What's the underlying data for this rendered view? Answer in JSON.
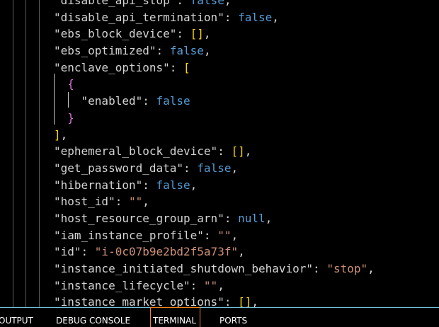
{
  "editor": {
    "lines": [
      [
        {
          "t": "\"disable_api_stop\"",
          "c": "k"
        },
        {
          "t": ": ",
          "c": "p"
        },
        {
          "t": "false",
          "c": "b"
        },
        {
          "t": ",",
          "c": "p"
        }
      ],
      [
        {
          "t": "\"disable_api_termination\"",
          "c": "k"
        },
        {
          "t": ": ",
          "c": "p"
        },
        {
          "t": "false",
          "c": "b"
        },
        {
          "t": ",",
          "c": "p"
        }
      ],
      [
        {
          "t": "\"ebs_block_device\"",
          "c": "k"
        },
        {
          "t": ": ",
          "c": "p"
        },
        {
          "t": "[]",
          "c": "br1"
        },
        {
          "t": ",",
          "c": "p"
        }
      ],
      [
        {
          "t": "\"ebs_optimized\"",
          "c": "k"
        },
        {
          "t": ": ",
          "c": "p"
        },
        {
          "t": "false",
          "c": "b"
        },
        {
          "t": ",",
          "c": "p"
        }
      ],
      [
        {
          "t": "\"enclave_options\"",
          "c": "k"
        },
        {
          "t": ": ",
          "c": "p"
        },
        {
          "t": "[",
          "c": "br1"
        }
      ],
      [
        {
          "t": "  {",
          "c": "br2"
        }
      ],
      [
        {
          "t": "    \"enabled\"",
          "c": "k"
        },
        {
          "t": ": ",
          "c": "p"
        },
        {
          "t": "false",
          "c": "b"
        }
      ],
      [
        {
          "t": "  }",
          "c": "br2"
        }
      ],
      [
        {
          "t": "]",
          "c": "br1"
        },
        {
          "t": ",",
          "c": "p"
        }
      ],
      [
        {
          "t": "\"ephemeral_block_device\"",
          "c": "k"
        },
        {
          "t": ": ",
          "c": "p"
        },
        {
          "t": "[]",
          "c": "br1"
        },
        {
          "t": ",",
          "c": "p"
        }
      ],
      [
        {
          "t": "\"get_password_data\"",
          "c": "k"
        },
        {
          "t": ": ",
          "c": "p"
        },
        {
          "t": "false",
          "c": "b"
        },
        {
          "t": ",",
          "c": "p"
        }
      ],
      [
        {
          "t": "\"hibernation\"",
          "c": "k"
        },
        {
          "t": ": ",
          "c": "p"
        },
        {
          "t": "false",
          "c": "b"
        },
        {
          "t": ",",
          "c": "p"
        }
      ],
      [
        {
          "t": "\"host_id\"",
          "c": "k"
        },
        {
          "t": ": ",
          "c": "p"
        },
        {
          "t": "\"\"",
          "c": "s"
        },
        {
          "t": ",",
          "c": "p"
        }
      ],
      [
        {
          "t": "\"host_resource_group_arn\"",
          "c": "k"
        },
        {
          "t": ": ",
          "c": "p"
        },
        {
          "t": "null",
          "c": "b"
        },
        {
          "t": ",",
          "c": "p"
        }
      ],
      [
        {
          "t": "\"iam_instance_profile\"",
          "c": "k"
        },
        {
          "t": ": ",
          "c": "p"
        },
        {
          "t": "\"\"",
          "c": "s"
        },
        {
          "t": ",",
          "c": "p"
        }
      ],
      [
        {
          "t": "\"id\"",
          "c": "k"
        },
        {
          "t": ": ",
          "c": "p"
        },
        {
          "t": "\"i-0c07b9e2bd2f5a73f\"",
          "c": "s"
        },
        {
          "t": ",",
          "c": "p"
        }
      ],
      [
        {
          "t": "\"instance_initiated_shutdown_behavior\"",
          "c": "k"
        },
        {
          "t": ": ",
          "c": "p"
        },
        {
          "t": "\"stop\"",
          "c": "s"
        },
        {
          "t": ",",
          "c": "p"
        }
      ],
      [
        {
          "t": "\"instance_lifecycle\"",
          "c": "k"
        },
        {
          "t": ": ",
          "c": "p"
        },
        {
          "t": "\"\"",
          "c": "s"
        },
        {
          "t": ",",
          "c": "p"
        }
      ],
      [
        {
          "t": "\"instance_market_options\"",
          "c": "k"
        },
        {
          "t": ": ",
          "c": "p"
        },
        {
          "t": "[]",
          "c": "br1"
        },
        {
          "t": ",",
          "c": "p"
        }
      ]
    ]
  },
  "panel": {
    "tabs": [
      {
        "label": "OUTPUT",
        "active": false
      },
      {
        "label": "DEBUG CONSOLE",
        "active": false
      },
      {
        "label": "TERMINAL",
        "active": true
      },
      {
        "label": "PORTS",
        "active": false
      }
    ]
  },
  "colors": {
    "key": "#d4d4d4",
    "boolean": "#569cd6",
    "string": "#ce9178",
    "bracket_level1": "#ffd700",
    "bracket_level2": "#da70d6",
    "active_tab_border": "#f38518"
  }
}
